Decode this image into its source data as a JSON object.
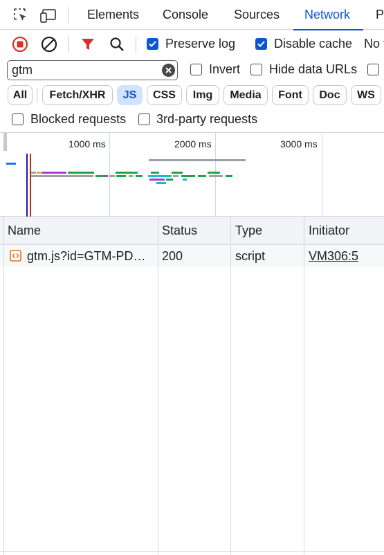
{
  "tabs": {
    "items": [
      {
        "label": "Elements"
      },
      {
        "label": "Console"
      },
      {
        "label": "Sources"
      },
      {
        "label": "Network"
      },
      {
        "label": "P"
      }
    ],
    "active": "Network"
  },
  "toolbar": {
    "preserve_log_label": "Preserve log",
    "preserve_log_checked": true,
    "disable_cache_label": "Disable cache",
    "disable_cache_checked": true,
    "throttle_label": "No t"
  },
  "filter": {
    "value": "gtm",
    "invert_label": "Invert",
    "hide_data_urls_label": "Hide data URLs"
  },
  "type_chips": [
    {
      "label": "All"
    },
    {
      "label": "Fetch/XHR"
    },
    {
      "label": "JS",
      "active": true
    },
    {
      "label": "CSS"
    },
    {
      "label": "Img"
    },
    {
      "label": "Media"
    },
    {
      "label": "Font"
    },
    {
      "label": "Doc"
    },
    {
      "label": "WS"
    }
  ],
  "extra_filters": {
    "blocked_requests_label": "Blocked requests",
    "third_party_label": "3rd-party requests"
  },
  "overview": {
    "time_labels": [
      "1000 ms",
      "2000 ms",
      "3000 ms"
    ],
    "colors": {
      "script": "#1ea446",
      "style": "#a83ad6",
      "other": "#9aa0a6",
      "image": "#20b8c9",
      "blue": "#1a73e8",
      "dom_content_loaded": "#1a1aa6",
      "load": "#c5221f"
    }
  },
  "table": {
    "columns": [
      "Name",
      "Status",
      "Type",
      "Initiator"
    ],
    "rows": [
      {
        "name": "gtm.js?id=GTM-PD…",
        "status": "200",
        "type": "script",
        "initiator": "VM306:5"
      }
    ]
  }
}
